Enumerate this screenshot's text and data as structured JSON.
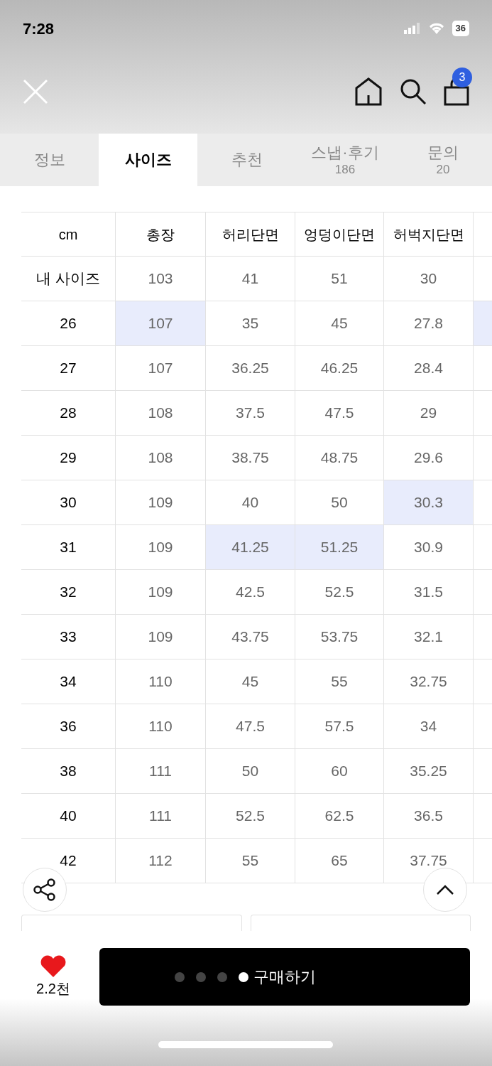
{
  "status_bar": {
    "time": "7:28",
    "battery": "36"
  },
  "header": {
    "cart_count": "3"
  },
  "tabs": [
    {
      "label": "정보",
      "selected": false
    },
    {
      "label": "사이즈",
      "selected": true
    },
    {
      "label": "추천",
      "selected": false
    },
    {
      "label": "스냅·후기",
      "count": "186",
      "selected": false
    },
    {
      "label": "문의",
      "count": "20",
      "selected": false
    }
  ],
  "table": {
    "columns": [
      "cm",
      "총장",
      "허리단면",
      "엉덩이단면",
      "허벅지단면"
    ],
    "rows": [
      {
        "cells": [
          {
            "value": "내 사이즈",
            "highlighted": false
          },
          {
            "value": "103",
            "highlighted": false
          },
          {
            "value": "41",
            "highlighted": false
          },
          {
            "value": "51",
            "highlighted": false
          },
          {
            "value": "30",
            "highlighted": false
          },
          {
            "highlighted": false
          }
        ]
      },
      {
        "cells": [
          {
            "value": "26",
            "highlighted": false
          },
          {
            "value": "107",
            "highlighted": true
          },
          {
            "value": "35",
            "highlighted": false
          },
          {
            "value": "45",
            "highlighted": false
          },
          {
            "value": "27.8",
            "highlighted": false
          },
          {
            "highlighted": true
          }
        ]
      },
      {
        "cells": [
          {
            "value": "27",
            "highlighted": false
          },
          {
            "value": "107",
            "highlighted": false
          },
          {
            "value": "36.25",
            "highlighted": false
          },
          {
            "value": "46.25",
            "highlighted": false
          },
          {
            "value": "28.4",
            "highlighted": false
          },
          {
            "highlighted": false
          }
        ]
      },
      {
        "cells": [
          {
            "value": "28",
            "highlighted": false
          },
          {
            "value": "108",
            "highlighted": false
          },
          {
            "value": "37.5",
            "highlighted": false
          },
          {
            "value": "47.5",
            "highlighted": false
          },
          {
            "value": "29",
            "highlighted": false
          },
          {
            "highlighted": false
          }
        ]
      },
      {
        "cells": [
          {
            "value": "29",
            "highlighted": false
          },
          {
            "value": "108",
            "highlighted": false
          },
          {
            "value": "38.75",
            "highlighted": false
          },
          {
            "value": "48.75",
            "highlighted": false
          },
          {
            "value": "29.6",
            "highlighted": false
          },
          {
            "highlighted": false
          }
        ]
      },
      {
        "cells": [
          {
            "value": "30",
            "highlighted": false
          },
          {
            "value": "109",
            "highlighted": false
          },
          {
            "value": "40",
            "highlighted": false
          },
          {
            "value": "50",
            "highlighted": false
          },
          {
            "value": "30.3",
            "highlighted": true
          },
          {
            "highlighted": false
          }
        ]
      },
      {
        "cells": [
          {
            "value": "31",
            "highlighted": false
          },
          {
            "value": "109",
            "highlighted": false
          },
          {
            "value": "41.25",
            "highlighted": true
          },
          {
            "value": "51.25",
            "highlighted": true
          },
          {
            "value": "30.9",
            "highlighted": false
          },
          {
            "highlighted": false
          }
        ]
      },
      {
        "cells": [
          {
            "value": "32",
            "highlighted": false
          },
          {
            "value": "109",
            "highlighted": false
          },
          {
            "value": "42.5",
            "highlighted": false
          },
          {
            "value": "52.5",
            "highlighted": false
          },
          {
            "value": "31.5",
            "highlighted": false
          },
          {
            "highlighted": false
          }
        ]
      },
      {
        "cells": [
          {
            "value": "33",
            "highlighted": false
          },
          {
            "value": "109",
            "highlighted": false
          },
          {
            "value": "43.75",
            "highlighted": false
          },
          {
            "value": "53.75",
            "highlighted": false
          },
          {
            "value": "32.1",
            "highlighted": false
          },
          {
            "highlighted": false
          }
        ]
      },
      {
        "cells": [
          {
            "value": "34",
            "highlighted": false
          },
          {
            "value": "110",
            "highlighted": false
          },
          {
            "value": "45",
            "highlighted": false
          },
          {
            "value": "55",
            "highlighted": false
          },
          {
            "value": "32.75",
            "highlighted": false
          },
          {
            "highlighted": false
          }
        ]
      },
      {
        "cells": [
          {
            "value": "36",
            "highlighted": false
          },
          {
            "value": "110",
            "highlighted": false
          },
          {
            "value": "47.5",
            "highlighted": false
          },
          {
            "value": "57.5",
            "highlighted": false
          },
          {
            "value": "34",
            "highlighted": false
          },
          {
            "highlighted": false
          }
        ]
      },
      {
        "cells": [
          {
            "value": "38",
            "highlighted": false
          },
          {
            "value": "111",
            "highlighted": false
          },
          {
            "value": "50",
            "highlighted": false
          },
          {
            "value": "60",
            "highlighted": false
          },
          {
            "value": "35.25",
            "highlighted": false
          },
          {
            "highlighted": false
          }
        ]
      },
      {
        "cells": [
          {
            "value": "40",
            "highlighted": false
          },
          {
            "value": "111",
            "highlighted": false
          },
          {
            "value": "52.5",
            "highlighted": false
          },
          {
            "value": "62.5",
            "highlighted": false
          },
          {
            "value": "36.5",
            "highlighted": false
          },
          {
            "highlighted": false
          }
        ]
      },
      {
        "cells": [
          {
            "value": "42",
            "highlighted": false
          },
          {
            "value": "112",
            "highlighted": false
          },
          {
            "value": "55",
            "highlighted": false
          },
          {
            "value": "65",
            "highlighted": false
          },
          {
            "value": "37.75",
            "highlighted": false
          },
          {
            "highlighted": false
          }
        ]
      }
    ]
  },
  "bottom_bar": {
    "likes": "2.2천",
    "buy_button": "구매하기",
    "pager": [
      {
        "selected": false
      },
      {
        "selected": false
      },
      {
        "selected": false
      },
      {
        "selected": true
      }
    ]
  }
}
